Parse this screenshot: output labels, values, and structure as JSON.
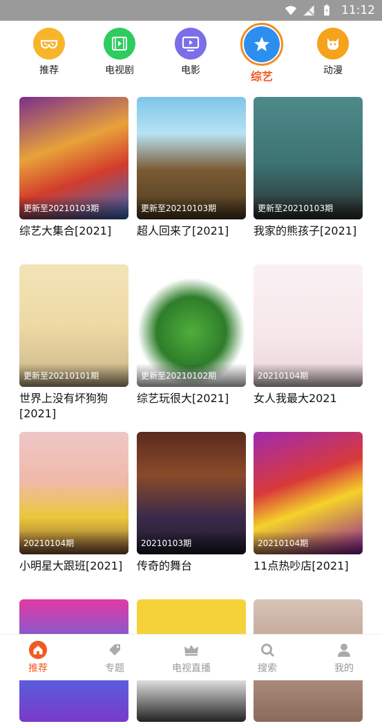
{
  "status": {
    "time": "11:12"
  },
  "categories": [
    {
      "label": "推荐",
      "icon": "sunglasses-icon",
      "color": "#f7b52c"
    },
    {
      "label": "电视剧",
      "icon": "film-icon",
      "color": "#2ecc5e"
    },
    {
      "label": "电影",
      "icon": "tv-icon",
      "color": "#7b6ee8"
    },
    {
      "label": "综艺",
      "icon": "star-icon",
      "color": "#2c8ff0",
      "active": true
    },
    {
      "label": "动漫",
      "icon": "cat-icon",
      "color": "#f7a21c"
    }
  ],
  "cards": [
    {
      "title": "综艺大集合[2021]",
      "badge": "更新至20210103期"
    },
    {
      "title": "超人回来了[2021]",
      "badge": "更新至20210103期"
    },
    {
      "title": "我家的熊孩子[2021]",
      "badge": "更新至20210103期"
    },
    {
      "title": "世界上没有坏狗狗[2021]",
      "badge": "更新至20210101期"
    },
    {
      "title": "综艺玩很大[2021]",
      "badge": "更新至20210102期"
    },
    {
      "title": "女人我最大2021",
      "badge": "20210104期"
    },
    {
      "title": "小明星大跟班[2021]",
      "badge": "20210104期"
    },
    {
      "title": "传奇的舞台",
      "badge": "20210103期"
    },
    {
      "title": "11点热吵店[2021]",
      "badge": "20210104期"
    },
    {
      "title": "",
      "badge": ""
    },
    {
      "title": "",
      "badge": ""
    },
    {
      "title": "",
      "badge": ""
    }
  ],
  "tabs": [
    {
      "label": "推荐",
      "icon": "home-icon",
      "active": true
    },
    {
      "label": "专题",
      "icon": "tag-icon"
    },
    {
      "label": "电视直播",
      "icon": "crown-icon"
    },
    {
      "label": "搜索",
      "icon": "search-icon"
    },
    {
      "label": "我的",
      "icon": "user-icon"
    }
  ],
  "colors": {
    "accent": "#f05a22",
    "inactive": "#999999"
  }
}
